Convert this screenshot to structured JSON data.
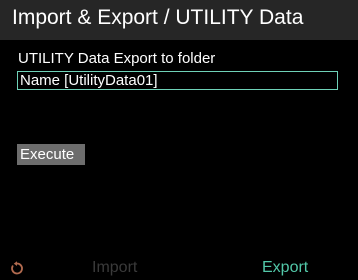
{
  "header": {
    "title": "Import & Export / UTILITY Data"
  },
  "main": {
    "subtitle": "UTILITY Data Export to folder",
    "name_field": {
      "value": "Name [UtilityData01]"
    },
    "execute_label": "Execute"
  },
  "footer": {
    "back_icon": "rotate-back-icon",
    "import_label": "Import",
    "export_label": "Export"
  },
  "colors": {
    "accent": "#52c7a8",
    "field_border": "#6fd2b8",
    "title_bar": "#262626",
    "button_bg": "#6d6d6d",
    "disabled_text": "#3a3a3a",
    "back_icon": "#b16a4f"
  }
}
